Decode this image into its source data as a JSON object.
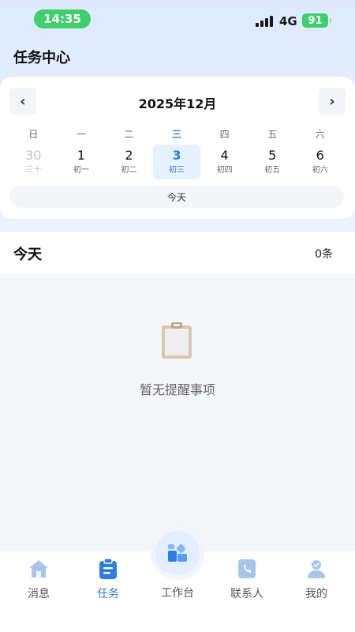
{
  "status_bar": {
    "time": "14:35",
    "network": "4G",
    "battery": "91"
  },
  "header": {
    "title": "任务中心"
  },
  "calendar": {
    "month_label": "2025年12月",
    "prev_icon": "chevron-left-icon",
    "next_icon": "chevron-right-icon",
    "weekdays": [
      "日",
      "一",
      "二",
      "三",
      "四",
      "五",
      "六"
    ],
    "days": [
      {
        "num": "30",
        "lunar": "三十",
        "state": "faded"
      },
      {
        "num": "1",
        "lunar": "初一",
        "state": "normal"
      },
      {
        "num": "2",
        "lunar": "初二",
        "state": "normal"
      },
      {
        "num": "3",
        "lunar": "初三",
        "state": "selected"
      },
      {
        "num": "4",
        "lunar": "初四",
        "state": "normal"
      },
      {
        "num": "5",
        "lunar": "初五",
        "state": "normal"
      },
      {
        "num": "6",
        "lunar": "初六",
        "state": "normal"
      }
    ],
    "today_button": "今天"
  },
  "section": {
    "title": "今天",
    "count": "0条"
  },
  "empty_state": {
    "icon": "clipboard-icon",
    "text": "暂无提醒事项"
  },
  "tab_bar": {
    "tabs": [
      {
        "label": "消息",
        "icon": "home-icon",
        "active": false
      },
      {
        "label": "任务",
        "icon": "task-clipboard-icon",
        "active": true
      },
      {
        "label": "工作台",
        "icon": "workbench-icon",
        "active": false
      },
      {
        "label": "联系人",
        "icon": "contact-phone-icon",
        "active": false
      },
      {
        "label": "我的",
        "icon": "user-profile-icon",
        "active": false
      }
    ]
  },
  "colors": {
    "accent": "#2f7de1",
    "status_green": "#3fcf6b",
    "selected_bg": "#e6f1ff"
  }
}
